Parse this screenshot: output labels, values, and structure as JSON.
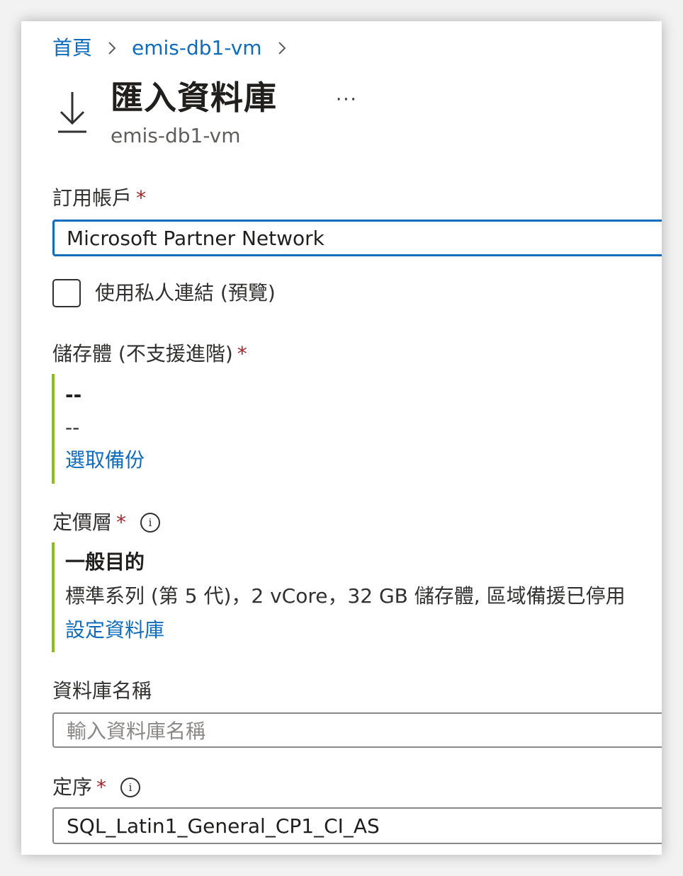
{
  "breadcrumb": {
    "items": [
      {
        "label": "首頁"
      },
      {
        "label": "emis-db1-vm"
      }
    ]
  },
  "header": {
    "title": "匯入資料庫",
    "subtitle": "emis-db1-vm",
    "more_label": "···",
    "icon": "download-icon"
  },
  "subscription": {
    "label": "訂用帳戶",
    "required_mark": "*",
    "value": "Microsoft Partner Network"
  },
  "private_link": {
    "label": "使用私人連結 (預覽)",
    "checked": false
  },
  "storage": {
    "label": "儲存體 (不支援進階)",
    "required_mark": "*",
    "line1": "--",
    "line2": "--",
    "link": "選取備份"
  },
  "pricing_tier": {
    "label": "定價層",
    "required_mark": "*",
    "info_icon": "info-icon",
    "info_glyph": "i",
    "tier_name": "一般目的",
    "tier_detail": "標準系列 (第 5 代)，2 vCore，32 GB 儲存體, 區域備援已停用",
    "link": "設定資料庫"
  },
  "database_name": {
    "label": "資料庫名稱",
    "placeholder": "輸入資料庫名稱"
  },
  "collation": {
    "label": "定序",
    "required_mark": "*",
    "info_glyph": "i",
    "value": "SQL_Latin1_General_CP1_CI_AS"
  },
  "colors": {
    "link": "#0f6cbd",
    "required": "#a4262c",
    "accent_bar": "#8cbd18",
    "focus_border": "#0f6cbd"
  }
}
